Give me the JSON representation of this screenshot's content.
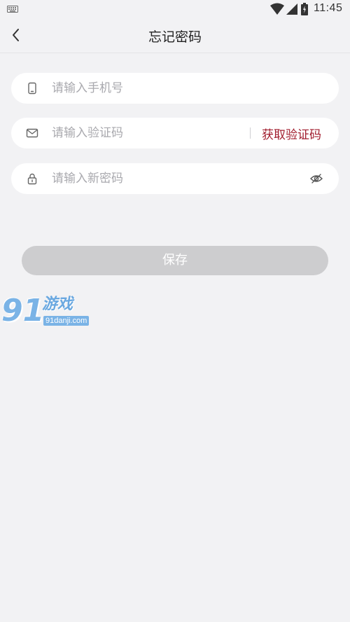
{
  "status_bar": {
    "time": "11:45",
    "icons": [
      "keyboard-icon",
      "wifi-icon",
      "cellular-signal-icon",
      "battery-icon"
    ]
  },
  "nav": {
    "title": "忘记密码",
    "back_icon": "chevron-left-icon"
  },
  "form": {
    "phone": {
      "placeholder": "请输入手机号",
      "value": "",
      "icon": "phone-icon"
    },
    "code": {
      "placeholder": "请输入验证码",
      "value": "",
      "icon": "mail-icon",
      "get_code_label": "获取验证码"
    },
    "password": {
      "placeholder": "请输入新密码",
      "value": "",
      "icon": "lock-icon",
      "toggle_icon": "eye-off-icon"
    },
    "save_label": "保存"
  },
  "watermark": {
    "number": "91",
    "name": "游戏",
    "url": "91danji.com"
  },
  "colors": {
    "background": "#f2f2f4",
    "accent": "#a01b2c",
    "button_disabled": "#cdcdcf",
    "field_bg": "#ffffff",
    "placeholder": "#a9a9ae"
  }
}
